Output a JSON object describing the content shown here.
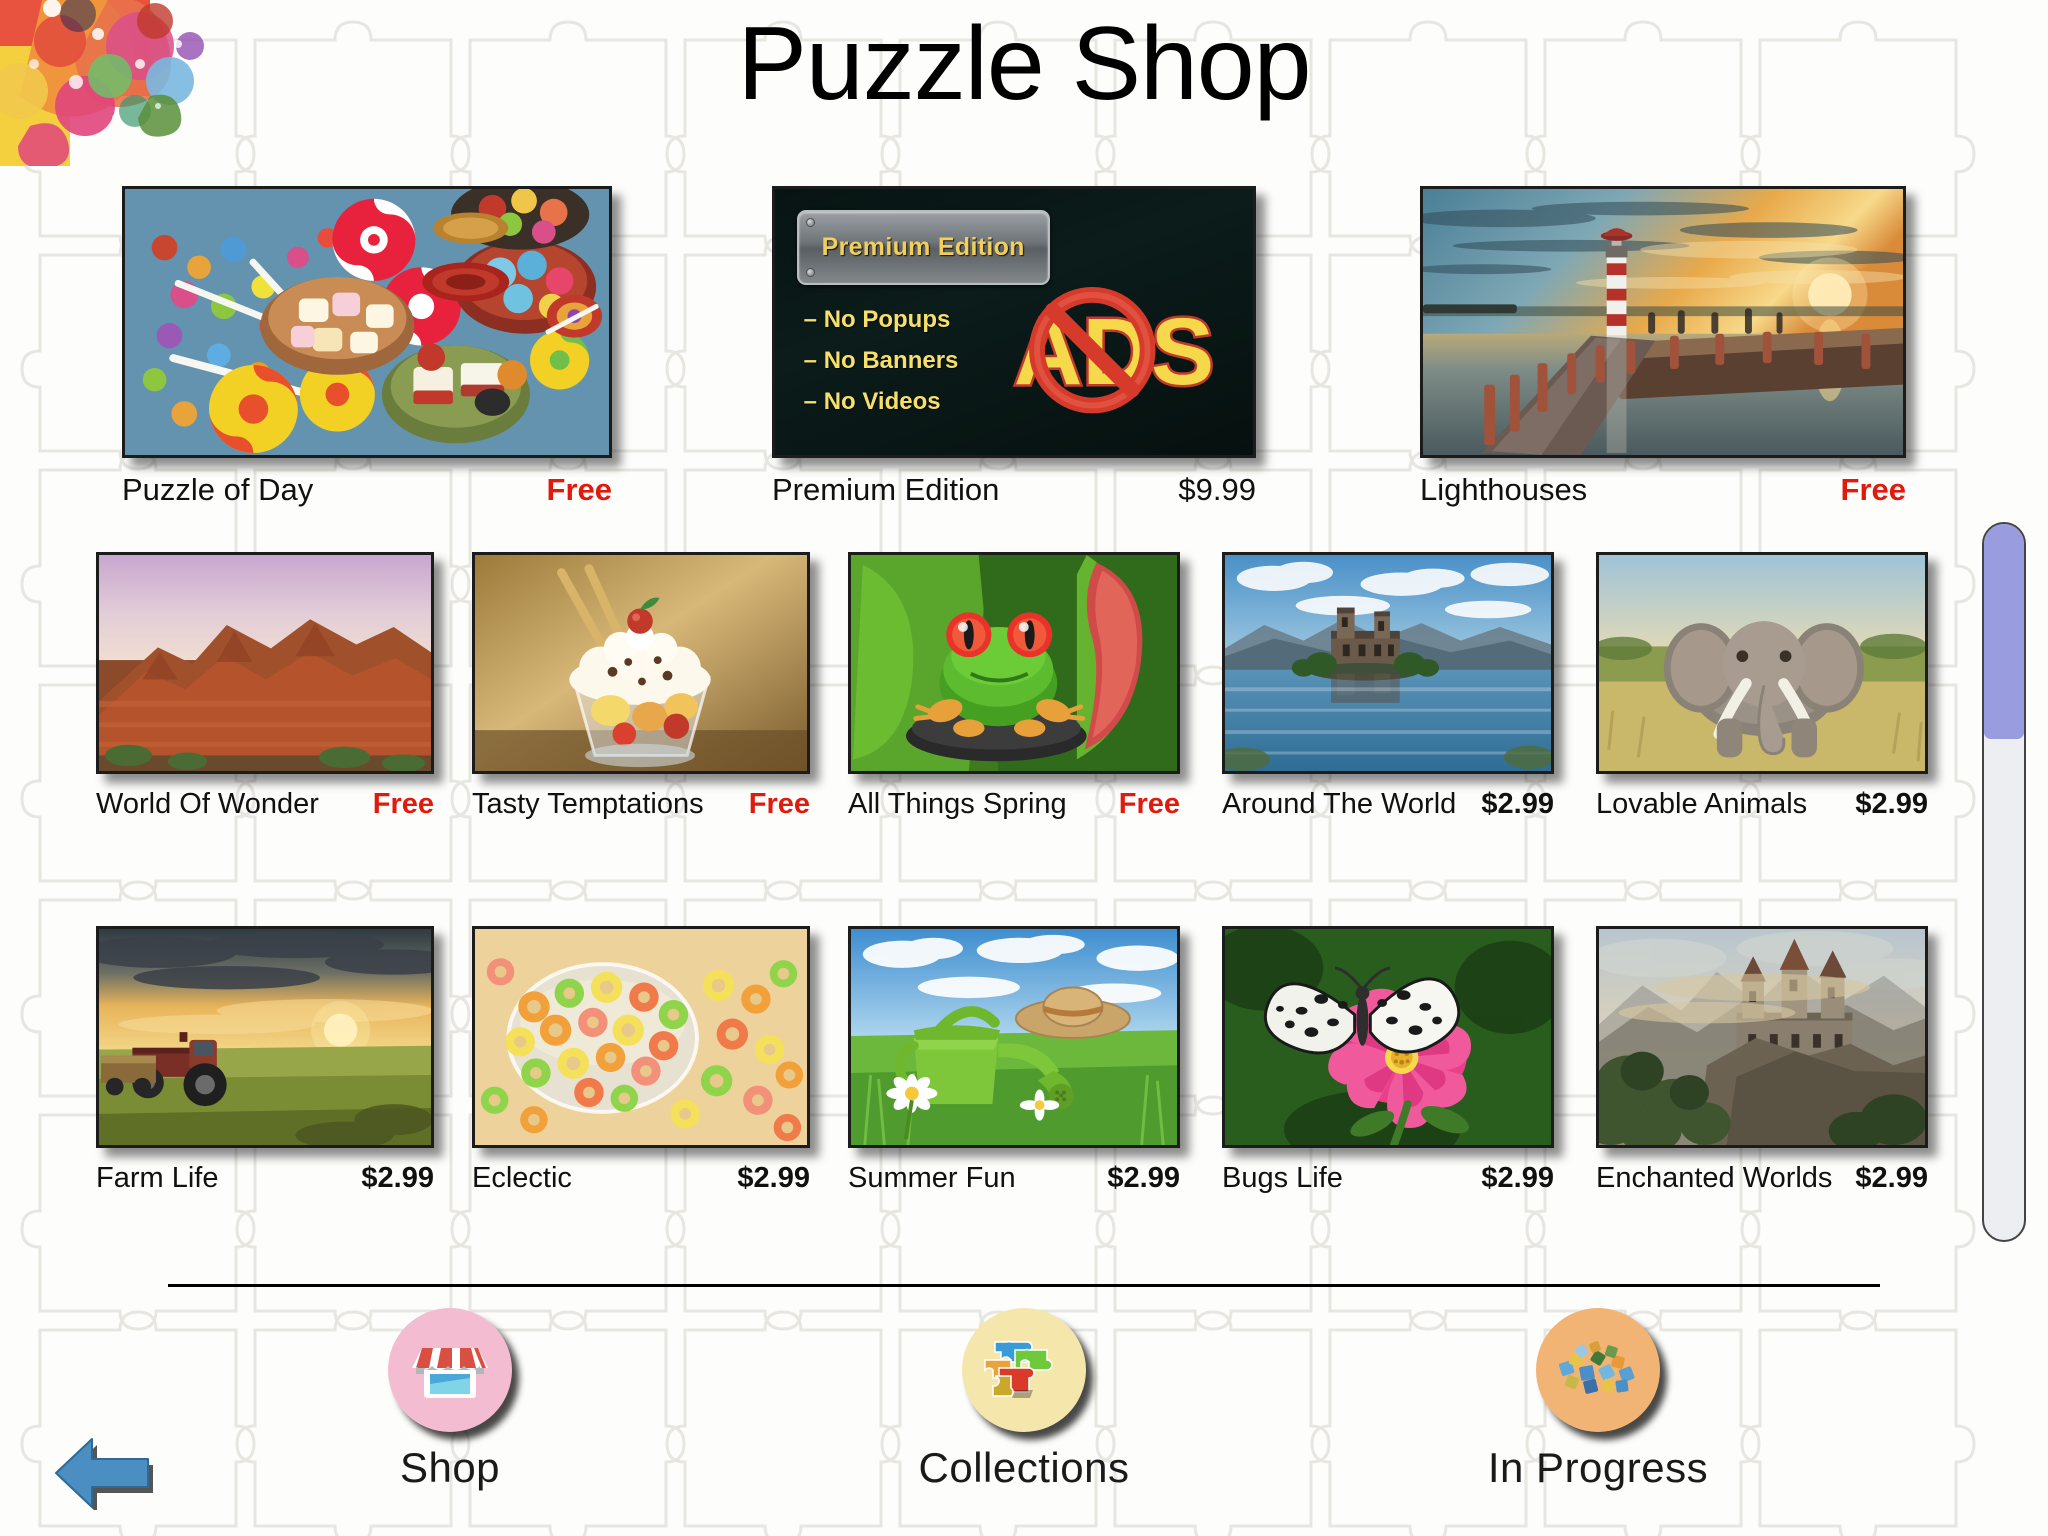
{
  "header": {
    "title": "Puzzle Shop"
  },
  "premium_banner": {
    "plaque_label": "Premium Edition",
    "features": [
      "–  No Popups",
      "–  No Banners",
      "–  No Videos"
    ],
    "badge_text": "ADS",
    "badge_icon": "no-ads-icon"
  },
  "colors": {
    "free_price": "#e01b0e",
    "paid_price": "#111111",
    "scrollbar_thumb": "#9a9ce0",
    "scrollbar_track": "#eceef2",
    "back_arrow": "#4a8ec2",
    "shop_circle": "#f3bcd0",
    "collections_circle": "#f5e7ac",
    "inprogress_circle": "#f2b474",
    "plaque_text": "#f2cf5b",
    "feature_text": "#f6df6a"
  },
  "scrollbar": {
    "name": "vertical-scrollbar",
    "thumb_position_percent": 0,
    "thumb_size_percent": 30
  },
  "rows": [
    {
      "id": "featured",
      "items": [
        {
          "name": "Puzzle of Day",
          "price": "Free",
          "free": true,
          "art": "candy"
        },
        {
          "name": "Premium Edition",
          "price": "$9.99",
          "free": false,
          "art": "premium"
        },
        {
          "name": "Lighthouses",
          "price": "Free",
          "free": true,
          "art": "lighthouse"
        }
      ]
    },
    {
      "id": "row-2",
      "items": [
        {
          "name": "World Of Wonder",
          "price": "Free",
          "free": true,
          "art": "canyon"
        },
        {
          "name": "Tasty Temptations",
          "price": "Free",
          "free": true,
          "art": "dessert"
        },
        {
          "name": "All Things Spring",
          "price": "Free",
          "free": true,
          "art": "frog"
        },
        {
          "name": "Around The World",
          "price": "$2.99",
          "free": false,
          "art": "castle-lake"
        },
        {
          "name": "Lovable Animals",
          "price": "$2.99",
          "free": false,
          "art": "elephant"
        }
      ]
    },
    {
      "id": "row-3",
      "items": [
        {
          "name": "Farm Life",
          "price": "$2.99",
          "free": false,
          "art": "tractor"
        },
        {
          "name": "Eclectic",
          "price": "$2.99",
          "free": false,
          "art": "cereal"
        },
        {
          "name": "Summer Fun",
          "price": "$2.99",
          "free": false,
          "art": "wateringcan"
        },
        {
          "name": "Bugs Life",
          "price": "$2.99",
          "free": false,
          "art": "butterfly"
        },
        {
          "name": "Enchanted Worlds",
          "price": "$2.99",
          "free": false,
          "art": "fantasy-castle"
        }
      ]
    }
  ],
  "bottom_nav": {
    "items": [
      {
        "label": "Shop",
        "icon": "storefront-icon",
        "active": true
      },
      {
        "label": "Collections",
        "icon": "puzzle-pieces-icon",
        "active": false
      },
      {
        "label": "In Progress",
        "icon": "scattered-puzzle-icon",
        "active": false
      }
    ]
  },
  "back_button": {
    "name": "back-arrow-button",
    "icon": "arrow-left-icon"
  }
}
